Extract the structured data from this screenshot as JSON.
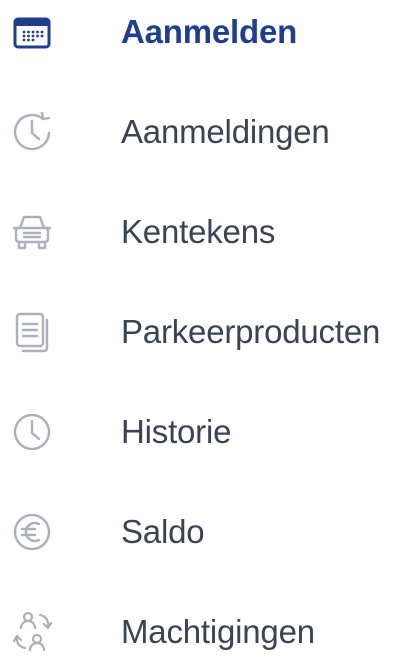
{
  "colors": {
    "active_text": "#1f3f8c",
    "inactive_text": "#3a4454",
    "icon_gray": "#aab1bb",
    "active_icon": "#1f3f8c"
  },
  "nav": {
    "items": [
      {
        "label": "Aanmelden",
        "icon": "calendar-icon",
        "active": true
      },
      {
        "label": "Aanmeldingen",
        "icon": "clock-refresh-icon",
        "active": false
      },
      {
        "label": "Kentekens",
        "icon": "car-icon",
        "active": false
      },
      {
        "label": "Parkeerproducten",
        "icon": "documents-icon",
        "active": false
      },
      {
        "label": "Historie",
        "icon": "clock-icon",
        "active": false
      },
      {
        "label": "Saldo",
        "icon": "euro-icon",
        "active": false
      },
      {
        "label": "Machtigingen",
        "icon": "users-swap-icon",
        "active": false
      }
    ]
  }
}
